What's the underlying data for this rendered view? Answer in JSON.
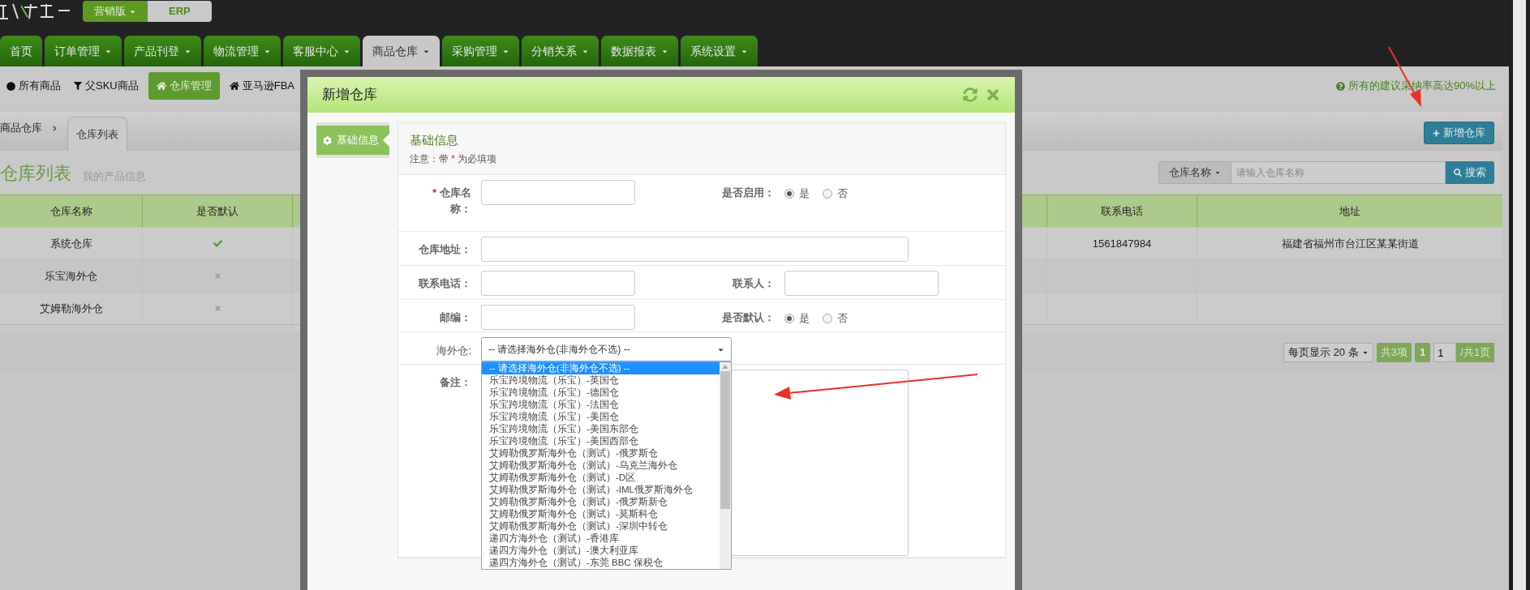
{
  "app": {
    "edition_menu": "营销版",
    "product_badge": "ERP"
  },
  "nav_tabs": [
    {
      "label": "首页",
      "caret": false,
      "selected": false
    },
    {
      "label": "订单管理",
      "caret": true,
      "selected": false
    },
    {
      "label": "产品刊登",
      "caret": true,
      "selected": false
    },
    {
      "label": "物流管理",
      "caret": true,
      "selected": false
    },
    {
      "label": "客服中心",
      "caret": true,
      "selected": false
    },
    {
      "label": "商品仓库",
      "caret": true,
      "selected": true
    },
    {
      "label": "采购管理",
      "caret": true,
      "selected": false
    },
    {
      "label": "分销关系",
      "caret": true,
      "selected": false
    },
    {
      "label": "数据报表",
      "caret": true,
      "selected": false
    },
    {
      "label": "系统设置",
      "caret": true,
      "selected": false
    }
  ],
  "sub_nav": {
    "items": [
      {
        "kind": "dot",
        "label": "所有商品",
        "selected": false
      },
      {
        "kind": "filter",
        "label": "父SKU商品",
        "selected": false
      },
      {
        "kind": "home",
        "label": "仓库管理",
        "selected": true
      },
      {
        "kind": "home",
        "label": "亚马逊FBA",
        "selected": false
      }
    ],
    "notice": "所有的建议采纳率高达90%以上"
  },
  "breadcrumb": {
    "parent": "商品仓库",
    "current_tab": "仓库列表"
  },
  "add_button": "新增仓库",
  "page_title": "仓库列表",
  "page_subtitle": "我的产品信息",
  "search": {
    "filter": "仓库名称",
    "placeholder": "请输入仓库名称",
    "button": "搜索"
  },
  "table": {
    "columns": [
      "仓库名称",
      "是否默认",
      "联系电话",
      "地址"
    ],
    "rows": [
      {
        "name": "系统仓库",
        "is_default": true,
        "phone": "1561847984",
        "address": "福建省福州市台江区某某街道"
      },
      {
        "name": "乐宝海外仓",
        "is_default": false
      },
      {
        "name": "艾姆勒海外仓",
        "is_default": false
      }
    ]
  },
  "pagination": {
    "page_size": "每页显示 20 条",
    "total": "共3项",
    "pages": [
      {
        "label": "1",
        "selected": true
      }
    ],
    "page_input": "1",
    "page_count": "/共1页"
  },
  "dialog": {
    "title": "新增仓库",
    "side_tabs": [
      {
        "label": "基础信息",
        "selected": true
      }
    ],
    "section_title": "基础信息",
    "note": {
      "before": "注意：带",
      "mark": "*",
      "after": "为必填项"
    },
    "rows": [
      {
        "fields": [
          {
            "kind": "text",
            "label": "仓库名称：",
            "required": true
          },
          {
            "kind": "radio",
            "label": "是否启用：",
            "required": false,
            "options": [
              {
                "label": "是",
                "selected": true
              },
              {
                "label": "否",
                "selected": false
              }
            ]
          }
        ]
      },
      {
        "fields": [
          {
            "kind": "wide_text",
            "label": "仓库地址：",
            "required": false
          }
        ]
      },
      {
        "fields": [
          {
            "kind": "text",
            "label": "联系电话：",
            "required": false
          },
          {
            "kind": "text",
            "label": "联系人：",
            "required": false
          }
        ]
      },
      {
        "fields": [
          {
            "kind": "text",
            "label": "邮编：",
            "required": false
          },
          {
            "kind": "radio",
            "label": "是否默认：",
            "required": false,
            "options": [
              {
                "label": "是",
                "selected": true
              },
              {
                "label": "否",
                "selected": false
              }
            ]
          }
        ]
      },
      {
        "fields": [
          {
            "kind": "select",
            "label": "海外仓:",
            "required": false,
            "value": "-- 请选择海外仓(非海外仓不选) --",
            "expanded": true,
            "options": [
              {
                "label": "-- 请选择海外仓(非海外仓不选) --",
                "selected": true
              },
              {
                "label": "乐宝跨境物流（乐宝）-英国仓",
                "selected": false
              },
              {
                "label": "乐宝跨境物流（乐宝）-德国仓",
                "selected": false
              },
              {
                "label": "乐宝跨境物流（乐宝）-法国仓",
                "selected": false
              },
              {
                "label": "乐宝跨境物流（乐宝）-美国仓",
                "selected": false
              },
              {
                "label": "乐宝跨境物流（乐宝）-美国东部仓",
                "selected": false
              },
              {
                "label": "乐宝跨境物流（乐宝）-美国西部仓",
                "selected": false
              },
              {
                "label": "艾姆勒俄罗斯海外仓（测试）-俄罗斯仓",
                "selected": false
              },
              {
                "label": "艾姆勒俄罗斯海外仓（测试）-乌克兰海外仓",
                "selected": false
              },
              {
                "label": "艾姆勒俄罗斯海外仓（测试）-D区",
                "selected": false
              },
              {
                "label": "艾姆勒俄罗斯海外仓（测试）-IML俄罗斯海外仓",
                "selected": false
              },
              {
                "label": "艾姆勒俄罗斯海外仓（测试）-俄罗斯新仓",
                "selected": false
              },
              {
                "label": "艾姆勒俄罗斯海外仓（测试）-莫斯科仓",
                "selected": false
              },
              {
                "label": "艾姆勒俄罗斯海外仓（测试）-深圳中转仓",
                "selected": false
              },
              {
                "label": "递四方海外仓（测试）-香港库",
                "selected": false
              },
              {
                "label": "递四方海外仓（测试）-澳大利亚库",
                "selected": false
              },
              {
                "label": "递四方海外仓（测试）-东莞 BBC 保税仓",
                "selected": false
              }
            ]
          }
        ]
      },
      {
        "fields": [
          {
            "kind": "textarea",
            "label": "备注：",
            "required": false
          }
        ]
      }
    ]
  }
}
